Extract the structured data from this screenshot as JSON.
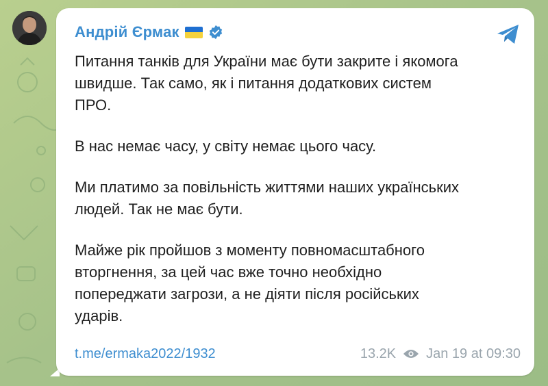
{
  "channel": {
    "author_name": "Андрій Єрмак",
    "flag_icon": "ukraine-flag-icon",
    "verified_icon": "verified-badge-icon",
    "app_icon": "telegram-icon"
  },
  "message": {
    "paragraphs": [
      "Питання танків для України має бути закрите і якомога\nшвидше. Так само, як і питання додаткових систем\nПРО.",
      "В нас немає часу, у світу немає цього часу.",
      "Ми платимо за повільність життями наших українських\nлюдей. Так не має бути.",
      "Майже рік пройшов з моменту повномасштабного\nвторгнення, за цей час вже точно необхідно\nпопереджати загрози, а не діяти після російських\nударів."
    ]
  },
  "footer": {
    "link_text": "t.me/ermaka2022/1932",
    "views": "13.2K",
    "views_icon": "eye-icon",
    "date": "Jan 19 at 09:30"
  },
  "colors": {
    "accent": "#3e8ed0",
    "background": "#a9c48c",
    "bubble": "#ffffff",
    "flag_blue": "#1f6fd1",
    "flag_yellow": "#f5d23c"
  }
}
